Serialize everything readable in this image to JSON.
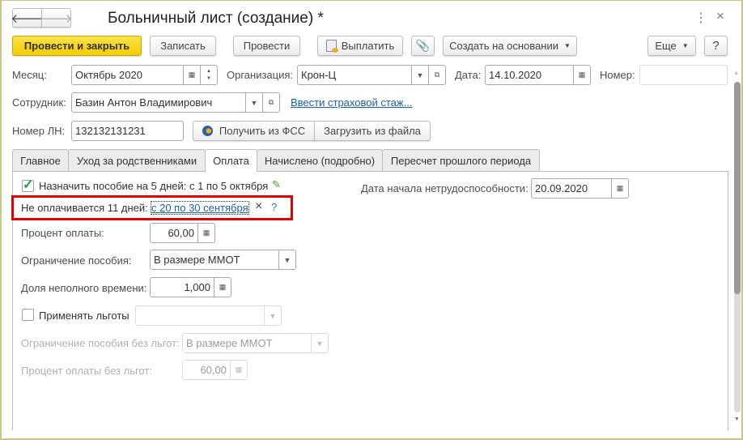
{
  "window": {
    "title": "Больничный лист (создание) *",
    "more_icon": "⋮",
    "close_icon": "×"
  },
  "toolbar": {
    "post_close": "Провести и закрыть",
    "save": "Записать",
    "post": "Провести",
    "pay": "Выплатить",
    "create_based": "Создать на основании",
    "more": "Еще",
    "help": "?"
  },
  "header": {
    "month_label": "Месяц:",
    "month_value": "Октябрь 2020",
    "org_label": "Организация:",
    "org_value": "Крон-Ц",
    "date_label": "Дата:",
    "date_value": "14.10.2020",
    "number_label": "Номер:",
    "number_value": "",
    "employee_label": "Сотрудник:",
    "employee_value": "Базин Антон Владимирович",
    "insurance_link": "Ввести страховой стаж...",
    "ln_label": "Номер ЛН:",
    "ln_value": "132132131231",
    "get_fss": "Получить из ФСС",
    "load_file": "Загрузить из файла"
  },
  "tabs": [
    {
      "label": "Главное"
    },
    {
      "label": "Уход за родственниками"
    },
    {
      "label": "Оплата",
      "active": true
    },
    {
      "label": "Начислено (подробно)"
    },
    {
      "label": "Пересчет прошлого периода"
    }
  ],
  "payment": {
    "assign_label": "Назначить пособие на 5 дней: с 1 по 5 октября",
    "assign_checked": true,
    "unpaid_label": "Не оплачивается 11 дней:",
    "unpaid_link": "с 20 по 30 сентября",
    "unpaid_clear": "×",
    "unpaid_help": "?",
    "start_label": "Дата начала нетрудоспособности:",
    "start_value": "20.09.2020",
    "percent_label": "Процент оплаты:",
    "percent_value": "60,00",
    "limit_label": "Ограничение пособия:",
    "limit_value": "В размере ММОТ",
    "part_label": "Доля неполного времени:",
    "part_value": "1,000",
    "benefits_label": "Применять льготы",
    "benefits_checked": false,
    "benefits_value": "",
    "limit_nb_label": "Ограничение пособия без льгот:",
    "limit_nb_value": "В размере ММОТ",
    "percent_nb_label": "Процент оплаты без льгот:",
    "percent_nb_value": "60,00"
  },
  "colors": {
    "primary": "#f2cb00",
    "highlight": "#e00000",
    "link": "#1a5fb4"
  }
}
